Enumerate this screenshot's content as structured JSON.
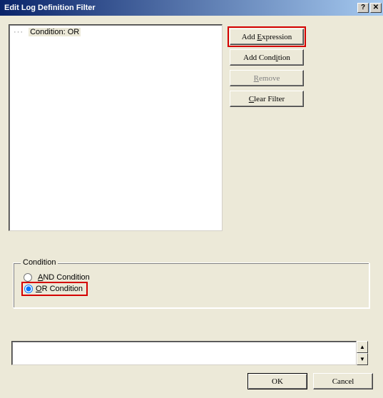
{
  "window": {
    "title": "Edit Log Definition Filter",
    "help_btn": "?",
    "close_btn": "✕"
  },
  "tree": {
    "root_label": "Condition: OR"
  },
  "buttons": {
    "add_expression_pre": "Add ",
    "add_expression_ul": "E",
    "add_expression_post": "xpression",
    "add_condition_pre": "Add Cond",
    "add_condition_ul": "i",
    "add_condition_post": "tion",
    "remove_ul": "R",
    "remove_post": "emove",
    "clear_filter_ul": "C",
    "clear_filter_post": "lear Filter"
  },
  "condition_group": {
    "legend": "Condition",
    "and_ul": "A",
    "and_post": "ND Condition",
    "or_ul": "O",
    "or_post": "R Condition",
    "selected": "or"
  },
  "footer": {
    "ok": "OK",
    "cancel": "Cancel"
  },
  "highlights": {
    "add_expression": true,
    "or_radio": true
  }
}
